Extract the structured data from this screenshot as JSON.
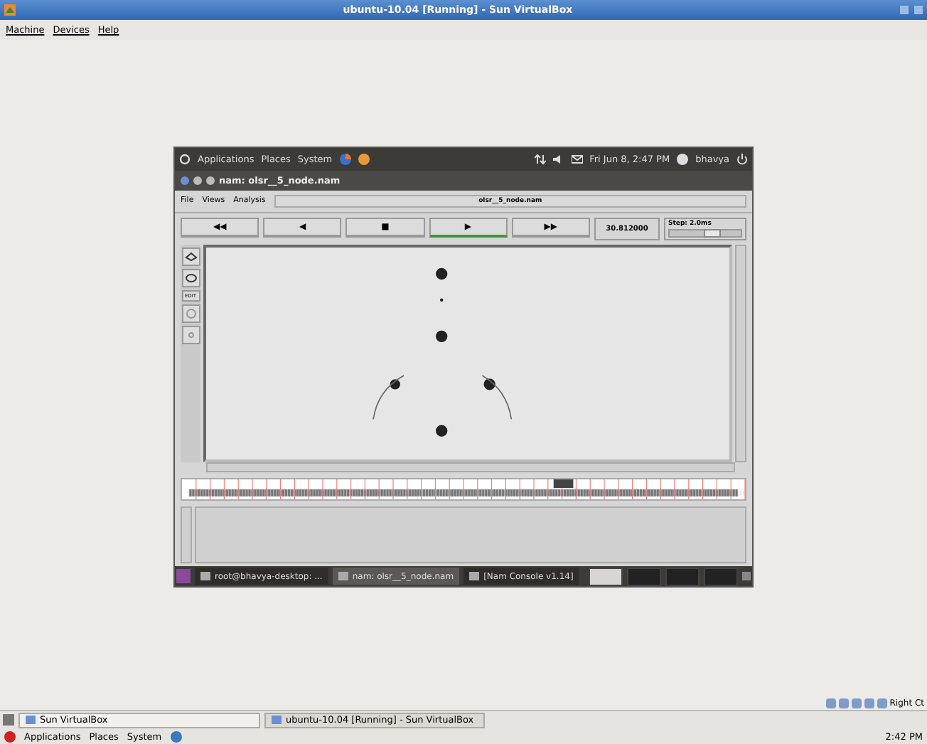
{
  "host_window": {
    "title": "ubuntu-10.04 [Running] - Sun VirtualBox"
  },
  "host_menu": [
    "Machine",
    "Devices",
    "Help"
  ],
  "guest": {
    "top_panel": {
      "menus": [
        "Applications",
        "Places",
        "System"
      ],
      "clock": "Fri Jun  8,  2:47 PM",
      "user": "bhavya"
    },
    "window_title": "nam: olsr__5_node.nam",
    "nam": {
      "menu": [
        "File",
        "Views",
        "Analysis"
      ],
      "file_name": "olsr__5_node.nam",
      "controls": [
        {
          "label": "◀◀",
          "selected": false
        },
        {
          "label": "◀",
          "selected": false
        },
        {
          "label": "■",
          "selected": false
        },
        {
          "label": "▶",
          "selected": true
        },
        {
          "label": "▶▶",
          "selected": false
        }
      ],
      "time": "30.812000",
      "step": {
        "label": "Step: 2.0ms",
        "level": 0.6
      },
      "edit_tool": "EDIT"
    },
    "taskbar": [
      {
        "label": "root@bhavya-desktop: ...",
        "selected": false
      },
      {
        "label": "nam: olsr__5_node.nam",
        "selected": true
      },
      {
        "label": "[Nam Console v1.14]",
        "selected": false
      }
    ]
  },
  "host_tray": {
    "label": "Right Ct"
  },
  "host_taskbar": [
    {
      "label": "Sun VirtualBox",
      "selected": false
    },
    {
      "label": "ubuntu-10.04 [Running] - Sun VirtualBox",
      "selected": true
    }
  ],
  "host_panel": {
    "menus": [
      "Applications",
      "Places",
      "System"
    ],
    "clock": "2:42 PM"
  }
}
